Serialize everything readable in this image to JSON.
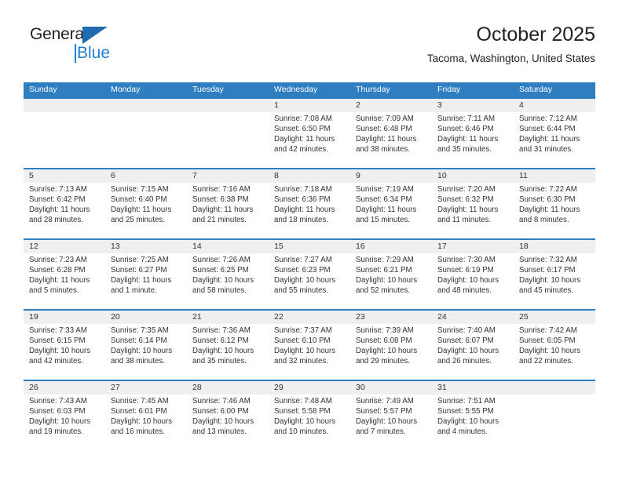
{
  "brand": {
    "name_top": "General",
    "name_bottom": "Blue",
    "color_dark": "#231f20",
    "color_blue": "#1f7fd0"
  },
  "header": {
    "title": "October 2025",
    "subtitle": "Tacoma, Washington, United States"
  },
  "theme": {
    "header_blue": "#2f7ec1",
    "row_band_gray": "#efefef",
    "text": "#333333"
  },
  "calendar": {
    "weekday_headers": [
      "Sunday",
      "Monday",
      "Tuesday",
      "Wednesday",
      "Thursday",
      "Friday",
      "Saturday"
    ],
    "weeks": [
      [
        {
          "day": "",
          "sunrise": "",
          "sunset": "",
          "daylight": "",
          "empty": true
        },
        {
          "day": "",
          "sunrise": "",
          "sunset": "",
          "daylight": "",
          "empty": true
        },
        {
          "day": "",
          "sunrise": "",
          "sunset": "",
          "daylight": "",
          "empty": true
        },
        {
          "day": "1",
          "sunrise": "Sunrise: 7:08 AM",
          "sunset": "Sunset: 6:50 PM",
          "daylight": "Daylight: 11 hours and 42 minutes."
        },
        {
          "day": "2",
          "sunrise": "Sunrise: 7:09 AM",
          "sunset": "Sunset: 6:48 PM",
          "daylight": "Daylight: 11 hours and 38 minutes."
        },
        {
          "day": "3",
          "sunrise": "Sunrise: 7:11 AM",
          "sunset": "Sunset: 6:46 PM",
          "daylight": "Daylight: 11 hours and 35 minutes."
        },
        {
          "day": "4",
          "sunrise": "Sunrise: 7:12 AM",
          "sunset": "Sunset: 6:44 PM",
          "daylight": "Daylight: 11 hours and 31 minutes."
        }
      ],
      [
        {
          "day": "5",
          "sunrise": "Sunrise: 7:13 AM",
          "sunset": "Sunset: 6:42 PM",
          "daylight": "Daylight: 11 hours and 28 minutes."
        },
        {
          "day": "6",
          "sunrise": "Sunrise: 7:15 AM",
          "sunset": "Sunset: 6:40 PM",
          "daylight": "Daylight: 11 hours and 25 minutes."
        },
        {
          "day": "7",
          "sunrise": "Sunrise: 7:16 AM",
          "sunset": "Sunset: 6:38 PM",
          "daylight": "Daylight: 11 hours and 21 minutes."
        },
        {
          "day": "8",
          "sunrise": "Sunrise: 7:18 AM",
          "sunset": "Sunset: 6:36 PM",
          "daylight": "Daylight: 11 hours and 18 minutes."
        },
        {
          "day": "9",
          "sunrise": "Sunrise: 7:19 AM",
          "sunset": "Sunset: 6:34 PM",
          "daylight": "Daylight: 11 hours and 15 minutes."
        },
        {
          "day": "10",
          "sunrise": "Sunrise: 7:20 AM",
          "sunset": "Sunset: 6:32 PM",
          "daylight": "Daylight: 11 hours and 11 minutes."
        },
        {
          "day": "11",
          "sunrise": "Sunrise: 7:22 AM",
          "sunset": "Sunset: 6:30 PM",
          "daylight": "Daylight: 11 hours and 8 minutes."
        }
      ],
      [
        {
          "day": "12",
          "sunrise": "Sunrise: 7:23 AM",
          "sunset": "Sunset: 6:28 PM",
          "daylight": "Daylight: 11 hours and 5 minutes."
        },
        {
          "day": "13",
          "sunrise": "Sunrise: 7:25 AM",
          "sunset": "Sunset: 6:27 PM",
          "daylight": "Daylight: 11 hours and 1 minute."
        },
        {
          "day": "14",
          "sunrise": "Sunrise: 7:26 AM",
          "sunset": "Sunset: 6:25 PM",
          "daylight": "Daylight: 10 hours and 58 minutes."
        },
        {
          "day": "15",
          "sunrise": "Sunrise: 7:27 AM",
          "sunset": "Sunset: 6:23 PM",
          "daylight": "Daylight: 10 hours and 55 minutes."
        },
        {
          "day": "16",
          "sunrise": "Sunrise: 7:29 AM",
          "sunset": "Sunset: 6:21 PM",
          "daylight": "Daylight: 10 hours and 52 minutes."
        },
        {
          "day": "17",
          "sunrise": "Sunrise: 7:30 AM",
          "sunset": "Sunset: 6:19 PM",
          "daylight": "Daylight: 10 hours and 48 minutes."
        },
        {
          "day": "18",
          "sunrise": "Sunrise: 7:32 AM",
          "sunset": "Sunset: 6:17 PM",
          "daylight": "Daylight: 10 hours and 45 minutes."
        }
      ],
      [
        {
          "day": "19",
          "sunrise": "Sunrise: 7:33 AM",
          "sunset": "Sunset: 6:15 PM",
          "daylight": "Daylight: 10 hours and 42 minutes."
        },
        {
          "day": "20",
          "sunrise": "Sunrise: 7:35 AM",
          "sunset": "Sunset: 6:14 PM",
          "daylight": "Daylight: 10 hours and 38 minutes."
        },
        {
          "day": "21",
          "sunrise": "Sunrise: 7:36 AM",
          "sunset": "Sunset: 6:12 PM",
          "daylight": "Daylight: 10 hours and 35 minutes."
        },
        {
          "day": "22",
          "sunrise": "Sunrise: 7:37 AM",
          "sunset": "Sunset: 6:10 PM",
          "daylight": "Daylight: 10 hours and 32 minutes."
        },
        {
          "day": "23",
          "sunrise": "Sunrise: 7:39 AM",
          "sunset": "Sunset: 6:08 PM",
          "daylight": "Daylight: 10 hours and 29 minutes."
        },
        {
          "day": "24",
          "sunrise": "Sunrise: 7:40 AM",
          "sunset": "Sunset: 6:07 PM",
          "daylight": "Daylight: 10 hours and 26 minutes."
        },
        {
          "day": "25",
          "sunrise": "Sunrise: 7:42 AM",
          "sunset": "Sunset: 6:05 PM",
          "daylight": "Daylight: 10 hours and 22 minutes."
        }
      ],
      [
        {
          "day": "26",
          "sunrise": "Sunrise: 7:43 AM",
          "sunset": "Sunset: 6:03 PM",
          "daylight": "Daylight: 10 hours and 19 minutes."
        },
        {
          "day": "27",
          "sunrise": "Sunrise: 7:45 AM",
          "sunset": "Sunset: 6:01 PM",
          "daylight": "Daylight: 10 hours and 16 minutes."
        },
        {
          "day": "28",
          "sunrise": "Sunrise: 7:46 AM",
          "sunset": "Sunset: 6:00 PM",
          "daylight": "Daylight: 10 hours and 13 minutes."
        },
        {
          "day": "29",
          "sunrise": "Sunrise: 7:48 AM",
          "sunset": "Sunset: 5:58 PM",
          "daylight": "Daylight: 10 hours and 10 minutes."
        },
        {
          "day": "30",
          "sunrise": "Sunrise: 7:49 AM",
          "sunset": "Sunset: 5:57 PM",
          "daylight": "Daylight: 10 hours and 7 minutes."
        },
        {
          "day": "31",
          "sunrise": "Sunrise: 7:51 AM",
          "sunset": "Sunset: 5:55 PM",
          "daylight": "Daylight: 10 hours and 4 minutes."
        },
        {
          "day": "",
          "sunrise": "",
          "sunset": "",
          "daylight": "",
          "empty": true
        }
      ]
    ]
  }
}
